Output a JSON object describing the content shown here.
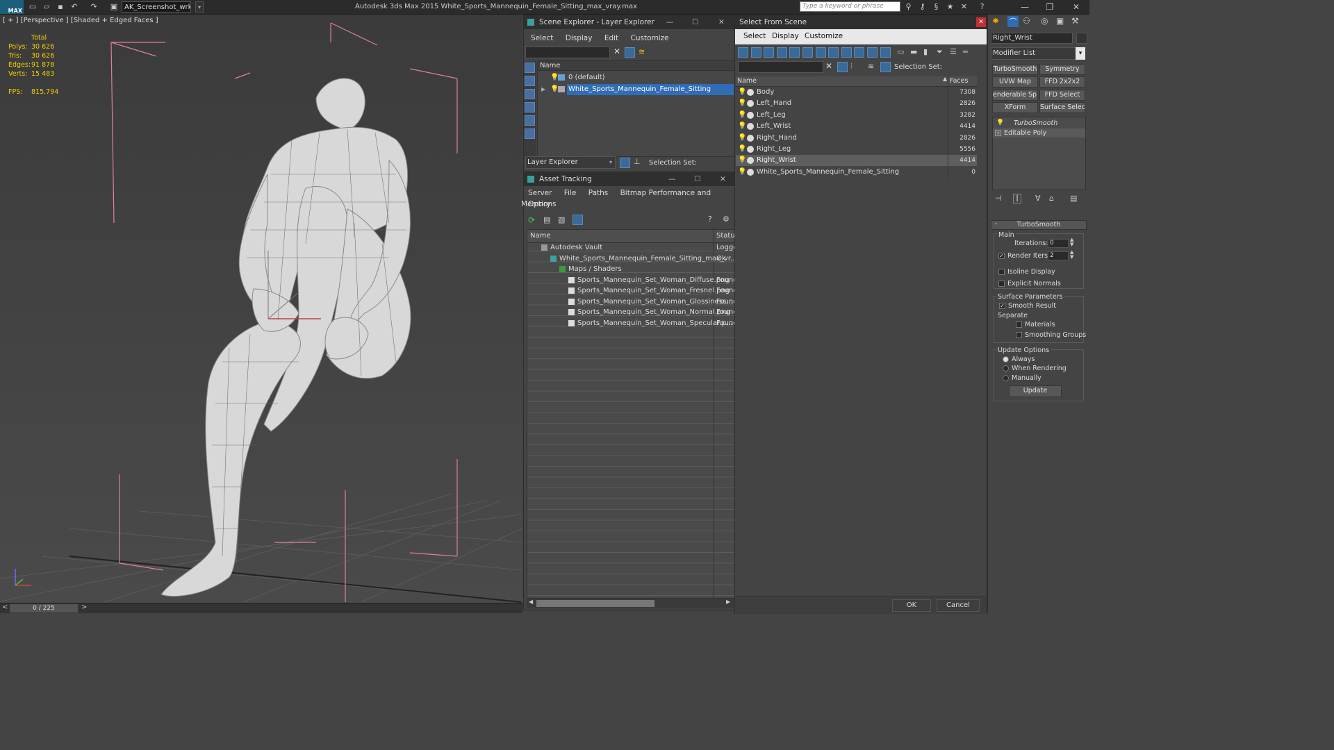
{
  "app": {
    "logo": "MAX",
    "workspace": "AK_Screenshot_wrksp",
    "title": "Autodesk 3ds Max  2015     White_Sports_Mannequin_Female_Sitting_max_vray.max",
    "search_placeholder": "Type a keyword or phrase"
  },
  "viewport": {
    "label": "[ + ] [Perspective ] [Shaded + Edged Faces ]",
    "stats": {
      "header": "Total",
      "rows": [
        {
          "label": "Polys:",
          "value": "30 626"
        },
        {
          "label": "Tris:",
          "value": "30 626"
        },
        {
          "label": "Edges:",
          "value": "91 878"
        },
        {
          "label": "Verts:",
          "value": "15 483"
        }
      ],
      "fps_label": "FPS:",
      "fps_value": "815,794"
    },
    "time_slider": "0 / 225",
    "prev": "<",
    "next": ">"
  },
  "layer_explorer": {
    "title": "Scene Explorer - Layer Explorer",
    "menu": [
      "Select",
      "Display",
      "Edit",
      "Customize"
    ],
    "col_name": "Name",
    "rows": [
      {
        "label": "0 (default)",
        "selected": false
      },
      {
        "label": "White_Sports_Mannequin_Female_Sitting",
        "selected": true
      }
    ],
    "footer_dropdown": "Layer Explorer",
    "selection_set": "Selection Set:"
  },
  "asset_tracking": {
    "title": "Asset Tracking",
    "menu": [
      "Server",
      "File",
      "Paths",
      "Bitmap Performance and Memory"
    ],
    "menu2": "Options",
    "col_name": "Name",
    "col_status": "Status",
    "rows": [
      {
        "name": "Autodesk Vault",
        "status": "Logge",
        "indent": 0
      },
      {
        "name": "White_Sports_Mannequin_Female_Sitting_max_vr...",
        "status": "Ok",
        "indent": 1
      },
      {
        "name": "Maps / Shaders",
        "status": "",
        "indent": 2
      },
      {
        "name": "Sports_Mannequin_Set_Woman_Diffuse.png",
        "status": "Found",
        "indent": 3
      },
      {
        "name": "Sports_Mannequin_Set_Woman_Fresnel.png",
        "status": "Found",
        "indent": 3
      },
      {
        "name": "Sports_Mannequin_Set_Woman_Glossiness...",
        "status": "Found",
        "indent": 3
      },
      {
        "name": "Sports_Mannequin_Set_Woman_Normal.png",
        "status": "Found",
        "indent": 3
      },
      {
        "name": "Sports_Mannequin_Set_Woman_Specular.p...",
        "status": "Found",
        "indent": 3
      }
    ]
  },
  "select_from_scene": {
    "title": "Select From Scene",
    "menu": [
      "Select",
      "Display",
      "Customize"
    ],
    "selection_set": "Selection Set:",
    "col_name": "Name",
    "col_faces": "Faces",
    "rows": [
      {
        "name": "Body",
        "faces": "7308",
        "selected": false
      },
      {
        "name": "Left_Hand",
        "faces": "2826",
        "selected": false
      },
      {
        "name": "Left_Leg",
        "faces": "3282",
        "selected": false
      },
      {
        "name": "Left_Wrist",
        "faces": "4414",
        "selected": false
      },
      {
        "name": "Right_Hand",
        "faces": "2826",
        "selected": false
      },
      {
        "name": "Right_Leg",
        "faces": "5556",
        "selected": false
      },
      {
        "name": "Right_Wrist",
        "faces": "4414",
        "selected": true
      },
      {
        "name": "White_Sports_Mannequin_Female_Sitting",
        "faces": "0",
        "selected": false
      }
    ],
    "ok": "OK",
    "cancel": "Cancel"
  },
  "command_panel": {
    "object_name": "Right_Wrist",
    "modifier_list": "Modifier List",
    "buttons": [
      "TurboSmooth",
      "Symmetry",
      "UVW Map",
      "FFD 2x2x2",
      "enderable Splin",
      "FFD Select",
      "XForm",
      "Surface Select"
    ],
    "stack": [
      "TurboSmooth",
      "Editable Poly"
    ],
    "rollout_title": "TurboSmooth",
    "main_label": "Main",
    "iterations_label": "Iterations:",
    "iterations_value": "0",
    "render_iters_label": "Render Iters:",
    "render_iters_value": "2",
    "isoline": "Isoline Display",
    "explicit_normals": "Explicit Normals",
    "surface_params": "Surface Parameters",
    "smooth_result": "Smooth Result",
    "separate": "Separate",
    "materials": "Materials",
    "smoothing_groups": "Smoothing Groups",
    "update_options": "Update Options",
    "always": "Always",
    "when_rendering": "When Rendering",
    "manually": "Manually",
    "update_button": "Update"
  }
}
